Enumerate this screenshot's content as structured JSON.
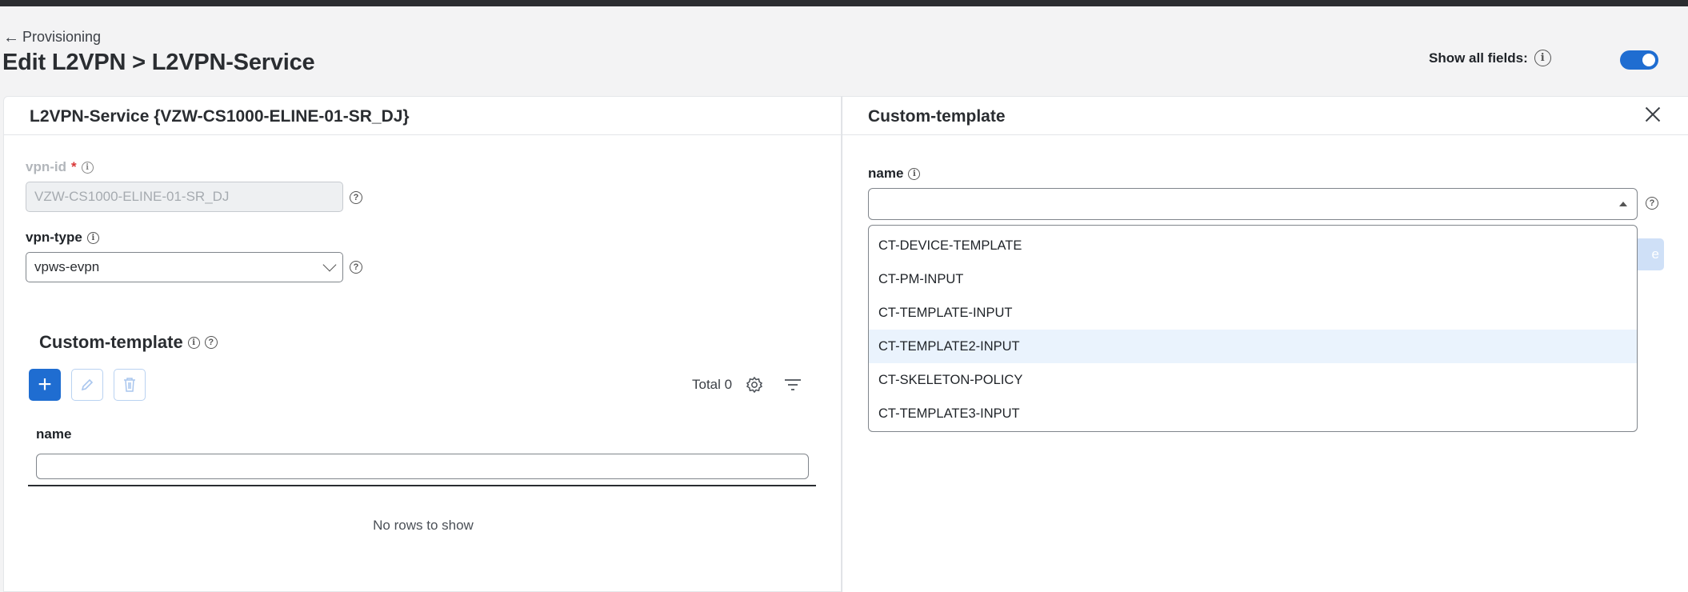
{
  "breadcrumb": {
    "back_label": "Provisioning"
  },
  "page": {
    "title": "Edit L2VPN > L2VPN-Service"
  },
  "show_all_fields": {
    "label": "Show all fields:",
    "enabled": true
  },
  "left_panel": {
    "title": "L2VPN-Service {VZW-CS1000-ELINE-01-SR_DJ}",
    "vpn_id": {
      "label": "vpn-id",
      "required_mark": "*",
      "value": "VZW-CS1000-ELINE-01-SR_DJ"
    },
    "vpn_type": {
      "label": "vpn-type",
      "value": "vpws-evpn"
    },
    "custom_template": {
      "title": "Custom-template",
      "total_label": "Total 0",
      "column_name": "name",
      "filter_value": "",
      "empty_message": "No rows to show"
    }
  },
  "right_panel": {
    "title": "Custom-template",
    "name_label": "name",
    "name_value": "",
    "options": [
      "CT-DEVICE-TEMPLATE",
      "CT-PM-INPUT",
      "CT-TEMPLATE-INPUT",
      "CT-TEMPLATE2-INPUT",
      "CT-SKELETON-POLICY",
      "CT-TEMPLATE3-INPUT"
    ],
    "highlighted_option": "CT-TEMPLATE2-INPUT",
    "partial_button_text": "e"
  },
  "icons": {
    "back": "arrow-left-icon",
    "info": "info-icon",
    "help": "help-icon",
    "add": "plus-icon",
    "edit": "pencil-icon",
    "delete": "trash-icon",
    "settings": "gear-icon",
    "filter": "filter-icon",
    "close": "close-icon"
  },
  "colors": {
    "primary": "#1f6dd1",
    "required": "#d93636",
    "highlight": "#eaf3fd"
  }
}
